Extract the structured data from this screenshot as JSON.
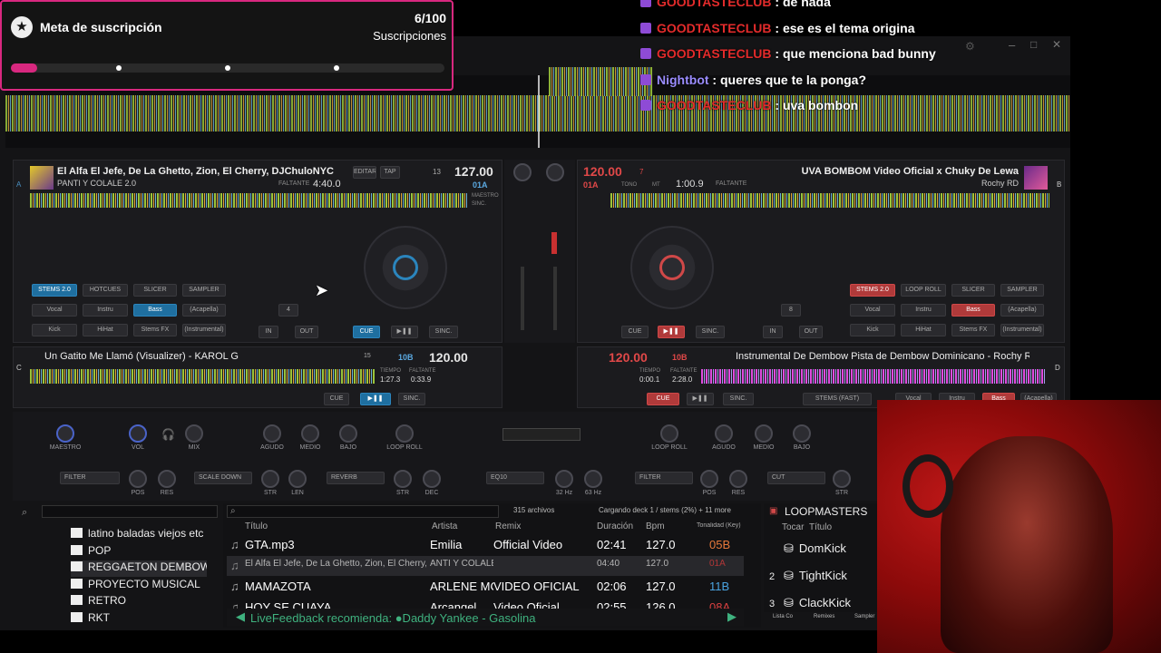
{
  "subscription_goal": {
    "title": "Meta de suscripción",
    "count": "6/100",
    "label": "Suscripciones",
    "progress": 0.06
  },
  "chat": [
    {
      "user": "GOODTASTECLUB",
      "message": "de nada",
      "user_color": "#e32b2b"
    },
    {
      "user": "GOODTASTECLUB",
      "message": "ese es el tema origina",
      "user_color": "#e32b2b"
    },
    {
      "user": "GOODTASTECLUB",
      "message": "que menciona bad bunny",
      "user_color": "#e32b2b"
    },
    {
      "user": "Nightbot",
      "message": "queres que te la ponga?",
      "user_color": "#9a8cff"
    },
    {
      "user": "GOODTASTECLUB",
      "message": "uva bombon",
      "user_color": "#e32b2b"
    }
  ],
  "deck_a": {
    "letter": "A",
    "artist": "El Alfa El Jefe, De La Ghetto, Zion, El Cherry, DJChuloNYC",
    "title": "PANTI Y COLALE 2.0",
    "bpm": "127.00",
    "remaining_label": "FALTANTE",
    "remaining": "4:40.0",
    "key": "01A",
    "edit": "EDITAR",
    "tap": "TAP",
    "bpm_small": "13",
    "master": "MAESTRO",
    "sync_label": "SINC."
  },
  "deck_b": {
    "letter": "B",
    "title": "UVA  BOMBOM  Video Oficial x Chuky De Lewa",
    "artist": "Rochy RD",
    "bpm": "120.00",
    "remaining": "1:00.9",
    "remaining_label": "FALTANTE",
    "key": "01A",
    "tone": "TONO",
    "mt": "MT",
    "num": "7"
  },
  "deck_c": {
    "letter": "C",
    "title": "Un Gatito Me Llamó (Visualizer) - KAROL G",
    "bpm": "120.00",
    "key": "10B",
    "time": "1:27.3",
    "remaining": "0:33.9",
    "time_label": "TIEMPO",
    "remaining_label": "FALTANTE",
    "num": "15"
  },
  "deck_d": {
    "letter": "D",
    "title": "Instrumental De Dembow  Pista de Dembow Dominicano - Rochy RD Ty",
    "bpm": "120.00",
    "key": "10B",
    "time": "0:00.1",
    "remaining": "2:28.0",
    "time_label": "TIEMPO",
    "remaining_label": "FALTANTE"
  },
  "deck_controls": {
    "cue": "CUE",
    "play": "▶❚❚",
    "sync": "SINC.",
    "in": "IN",
    "out": "OUT",
    "loop_a": "4",
    "loop_b": "8",
    "stems": "STEMS 2.0",
    "hotcues": "HOTCUES",
    "slicer": "SLICER",
    "sampler": "SAMPLER",
    "loop_roll": "LOOP ROLL",
    "vocal": "Vocal",
    "instru": "Instru",
    "bass": "Bass",
    "acapella": "(Acapella)",
    "kick": "Kick",
    "hihat": "HiHat",
    "stems_fx": "Stems FX",
    "instrumental": "(Instrumental)",
    "stems_fast": "STEMS (FAST)",
    "hotcue_label": "HOTCUE",
    "pads_label": "PADS"
  },
  "mixer": {
    "maestro": "MAESTRO",
    "vol": "VOL",
    "mix": "MIX",
    "agudo": "AGUDO",
    "medio": "MEDIO",
    "bajo": "BAJO",
    "loop_roll": "LOOP ROLL",
    "filter": "FILTER",
    "pos": "POS",
    "res": "RES",
    "scale_down": "SCALE DOWN",
    "str": "STR",
    "len": "LEN",
    "reverb": "REVERB",
    "dec": "DEC",
    "eq": "EQ10",
    "hz32": "32 Hz",
    "hz63": "63 Hz",
    "cut": "CUT",
    "gan": "GAN."
  },
  "browser": {
    "file_count": "315 archivos",
    "loading": "Cargando deck 1 / stems (2%) + 11 more",
    "folders": [
      "latino baladas viejos etc",
      "POP",
      "REGGAETON DEMBOW BR",
      "PROYECTO MUSICAL",
      "RETRO",
      "RKT"
    ],
    "columns": {
      "title": "Título",
      "artist": "Artista",
      "remix": "Remix",
      "duration": "Duración",
      "bpm": "Bpm",
      "key": "Tonalidad (Key)"
    },
    "rows": [
      {
        "title": "GTA.mp3",
        "artist": "Emilia",
        "remix": "Official Video",
        "duration": "02:41",
        "bpm": "127.0",
        "key": "05B",
        "key_color": "#e8793a"
      },
      {
        "title": "El Alfa El Jefe, De La Ghetto, Zion, El Cherry, DJCh",
        "artist": "ANTI Y COLALE",
        "remix": "",
        "duration": "04:40",
        "bpm": "127.0",
        "key": "01A",
        "key_color": "#d94040"
      },
      {
        "title": "MAMAZOTA",
        "artist": "ARLENE MC",
        "remix": "VIDEO OFICIAL",
        "duration": "02:06",
        "bpm": "127.0",
        "key": "11B",
        "key_color": "#4aa3e0"
      },
      {
        "title": "HOY SE CUAYA",
        "artist": "Arcangel",
        "remix": "Video Oficial",
        "duration": "02:55",
        "bpm": "126.0",
        "key": "08A",
        "key_color": "#d94040"
      }
    ],
    "livefeedback": "LiveFeedback recomienda: ●Daddy Yankee - Gasolina",
    "loopmasters": "LOOPMASTERS",
    "loop_cols": {
      "play": "Tocar",
      "title": "Título"
    },
    "loops": [
      {
        "n": "",
        "name": "DomKick"
      },
      {
        "n": "2",
        "name": "TightKick"
      },
      {
        "n": "3",
        "name": "ClackKick"
      }
    ]
  },
  "bottom_tabs": [
    "Lista Co",
    "Remixes",
    "Sampler",
    "Automix",
    "Karaoke",
    "ELECTR",
    "LOOPM"
  ],
  "colors": {
    "accent_blue": "#2b85bd",
    "accent_red": "#d04848",
    "goal_pink": "#d8287f"
  }
}
